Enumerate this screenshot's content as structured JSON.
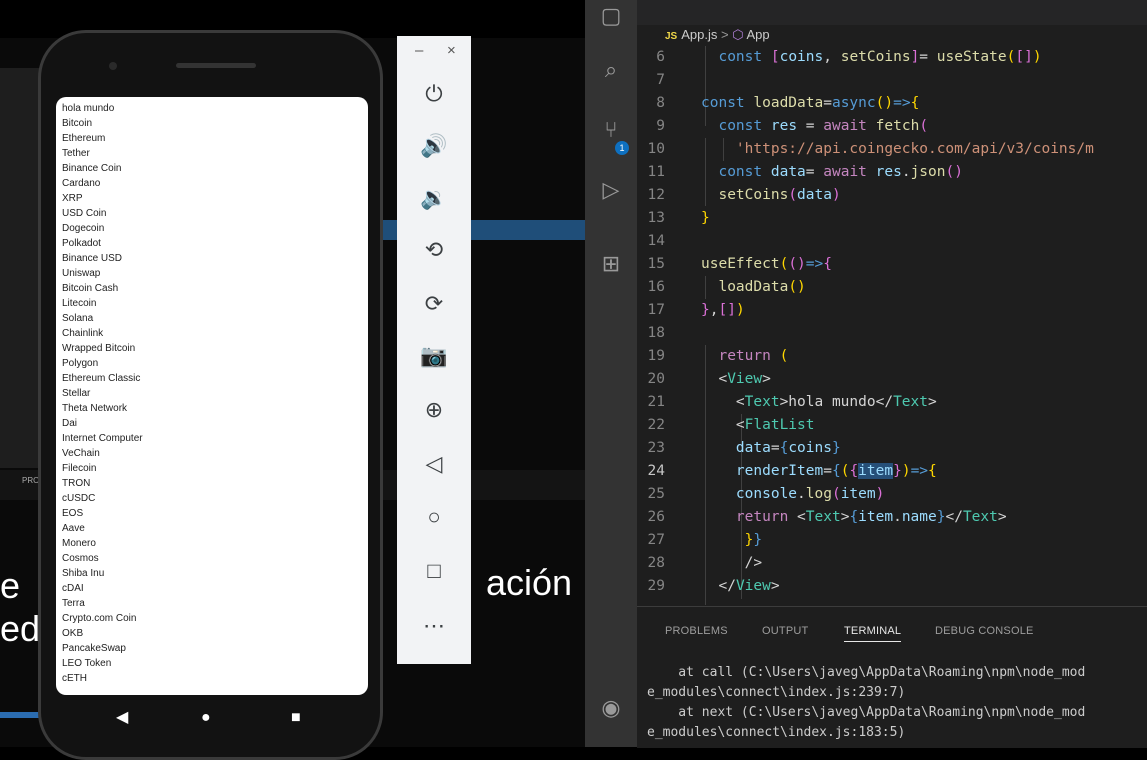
{
  "background": {
    "big_text_left": "e",
    "big_text_right": "ación",
    "big_text_line2": "ed",
    "problems_strip": "PRO"
  },
  "phone": {
    "list_items": [
      "hola mundo",
      "Bitcoin",
      "Ethereum",
      "Tether",
      "Binance Coin",
      "Cardano",
      "XRP",
      "USD Coin",
      "Dogecoin",
      "Polkadot",
      "Binance USD",
      "Uniswap",
      "Bitcoin Cash",
      "Litecoin",
      "Solana",
      "Chainlink",
      "Wrapped Bitcoin",
      "Polygon",
      "Ethereum Classic",
      "Stellar",
      "Theta Network",
      "Dai",
      "Internet Computer",
      "VeChain",
      "Filecoin",
      "TRON",
      "cUSDC",
      "EOS",
      "Aave",
      "Monero",
      "Cosmos",
      "Shiba Inu",
      "cDAI",
      "Terra",
      "Crypto.com Coin",
      "OKB",
      "PancakeSwap",
      "LEO Token",
      "cETH"
    ],
    "nav": {
      "back": "◀",
      "home": "●",
      "recents": "■"
    }
  },
  "emulator": {
    "minimize": "–",
    "close": "×",
    "buttons": [
      {
        "name": "power-icon",
        "glyph": "⏻"
      },
      {
        "name": "volume-up-icon",
        "glyph": "🔊"
      },
      {
        "name": "volume-down-icon",
        "glyph": "🔉"
      },
      {
        "name": "rotate-left-icon",
        "glyph": "⟲"
      },
      {
        "name": "rotate-right-icon",
        "glyph": "⟳"
      },
      {
        "name": "camera-icon",
        "glyph": "📷"
      },
      {
        "name": "zoom-icon",
        "glyph": "⊕"
      },
      {
        "name": "back-icon",
        "glyph": "◁"
      },
      {
        "name": "home-icon",
        "glyph": "○"
      },
      {
        "name": "overview-icon",
        "glyph": "□"
      },
      {
        "name": "more-icon",
        "glyph": "⋯"
      }
    ]
  },
  "vscode": {
    "breadcrumb": {
      "lang": "JS",
      "file": "App.js",
      "sep": ">",
      "symbol": "App"
    },
    "scm_badge": "1",
    "panel_tabs": [
      "PROBLEMS",
      "OUTPUT",
      "TERMINAL",
      "DEBUG CONSOLE"
    ],
    "active_panel_tab": "TERMINAL",
    "terminal_lines": [
      "    at call (C:\\Users\\javeg\\AppData\\Roaming\\npm\\node_mod",
      "e_modules\\connect\\index.js:239:7)",
      "    at next (C:\\Users\\javeg\\AppData\\Roaming\\npm\\node_mod",
      "e_modules\\connect\\index.js:183:5)"
    ],
    "active_line": "24"
  }
}
